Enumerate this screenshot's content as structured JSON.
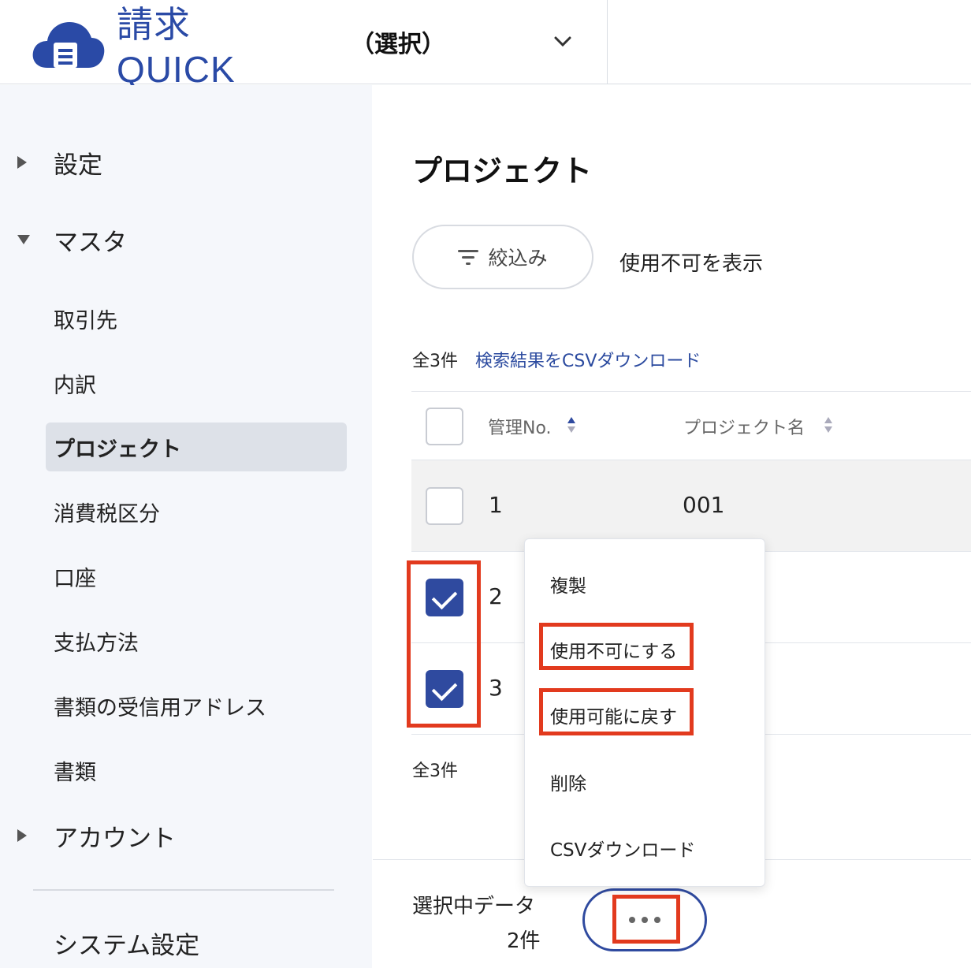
{
  "header": {
    "logo_text": "請求QUICK",
    "org_selector": "（選択）"
  },
  "sidebar": {
    "groups": [
      {
        "label": "設定"
      },
      {
        "label": "マスタ"
      },
      {
        "label": "アカウント"
      },
      {
        "label": "システム設定"
      }
    ],
    "master_items": [
      {
        "label": "取引先"
      },
      {
        "label": "内訳"
      },
      {
        "label": "プロジェクト"
      },
      {
        "label": "消費税区分"
      },
      {
        "label": "口座"
      },
      {
        "label": "支払方法"
      },
      {
        "label": "書類の受信用アドレス"
      },
      {
        "label": "書類"
      }
    ]
  },
  "main": {
    "title": "プロジェクト",
    "filter_label": "絞込み",
    "show_disabled_label": "使用不可を表示",
    "count_top": "全3件",
    "csv_link": "検索結果をCSVダウンロード",
    "count_bottom": "全3件",
    "table": {
      "columns": [
        "管理No.",
        "プロジェクト名"
      ],
      "rows": [
        {
          "no": "1",
          "name": "001",
          "checked": false
        },
        {
          "no": "2",
          "name": "",
          "checked": true
        },
        {
          "no": "3",
          "name": "",
          "checked": true
        }
      ]
    }
  },
  "bottom_bar": {
    "selected_label": "選択中データ",
    "selected_count": "2件"
  },
  "menu": {
    "items": [
      "複製",
      "使用不可にする",
      "使用可能に戻す",
      "削除",
      "CSVダウンロード"
    ]
  },
  "colors": {
    "brand": "#2a4aa6",
    "accent": "#2f4a9f",
    "highlight": "#e23a1e",
    "sidebar_bg": "#f5f7fb"
  }
}
